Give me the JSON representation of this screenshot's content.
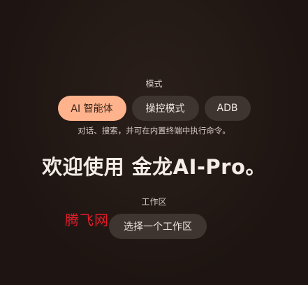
{
  "mode": {
    "label": "模式",
    "options": [
      {
        "label": "AI 智能体",
        "active": true
      },
      {
        "label": "操控模式",
        "active": false
      },
      {
        "label": "ADB",
        "active": false
      }
    ],
    "description": "对话、搜索，并可在内置终端中执行命令。"
  },
  "welcome": {
    "text": "欢迎使用 金龙AI-Pro。"
  },
  "workspace": {
    "label": "工作区",
    "button_label": "选择一个工作区"
  },
  "watermark": {
    "text": "腾飞网"
  },
  "colors": {
    "background": "#201714",
    "active_pill": "#ffb38d",
    "pill": "#3e3430",
    "watermark": "#e21c2a"
  }
}
